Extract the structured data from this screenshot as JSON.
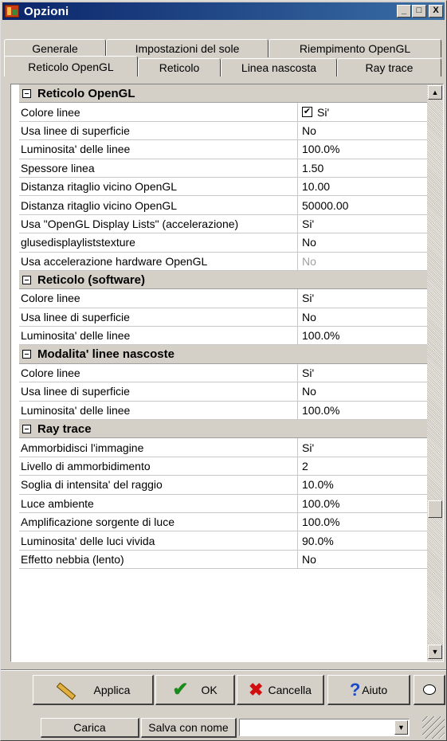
{
  "window": {
    "title": "Opzioni"
  },
  "titlebar_buttons": {
    "minimize": "_",
    "maximize": "□",
    "close": "X"
  },
  "tabs_back": [
    "Generale",
    "Impostazioni del sole",
    "Riempimento OpenGL"
  ],
  "tabs_front": [
    "Reticolo OpenGL",
    "Reticolo",
    "Linea nascosta",
    "Ray trace"
  ],
  "active_tab": "Reticolo OpenGL",
  "grid": {
    "sections": [
      {
        "title": "Reticolo OpenGL",
        "rows": [
          {
            "name": "Colore linee",
            "value": "Si'",
            "checkbox": true
          },
          {
            "name": "Usa linee di superficie",
            "value": "No"
          },
          {
            "name": "Luminosita' delle linee",
            "value": "100.0%"
          },
          {
            "name": "Spessore linea",
            "value": "1.50"
          },
          {
            "name": "Distanza ritaglio vicino OpenGL",
            "value": "10.00"
          },
          {
            "name": "Distanza ritaglio vicino OpenGL",
            "value": "50000.00"
          },
          {
            "name": "Usa \"OpenGL Display Lists\" (accelerazione)",
            "value": "Si'"
          },
          {
            "name": "glusedisplayliststexture",
            "value": "No"
          },
          {
            "name": "Usa accelerazione hardware OpenGL",
            "value": "No",
            "disabled": true
          }
        ]
      },
      {
        "title": "Reticolo (software)",
        "rows": [
          {
            "name": "Colore linee",
            "value": "Si'"
          },
          {
            "name": "Usa linee di superficie",
            "value": "No"
          },
          {
            "name": "Luminosita' delle linee",
            "value": "100.0%"
          }
        ]
      },
      {
        "title": "Modalita' linee nascoste",
        "rows": [
          {
            "name": "Colore linee",
            "value": "Si'"
          },
          {
            "name": "Usa linee di superficie",
            "value": "No"
          },
          {
            "name": "Luminosita' delle linee",
            "value": "100.0%"
          }
        ]
      },
      {
        "title": "Ray trace",
        "rows": [
          {
            "name": "Ammorbidisci l'immagine",
            "value": "Si'"
          },
          {
            "name": "Livello di ammorbidimento",
            "value": "2"
          },
          {
            "name": "Soglia di intensita' del raggio",
            "value": "10.0%"
          },
          {
            "name": "Luce ambiente",
            "value": "100.0%"
          },
          {
            "name": "Amplificazione sorgente di luce",
            "value": "100.0%"
          },
          {
            "name": "Luminosita' delle luci vivida",
            "value": "90.0%"
          },
          {
            "name": "Effetto nebbia (lento)",
            "value": "No"
          }
        ]
      }
    ]
  },
  "buttons": {
    "apply": "Applica",
    "ok": "OK",
    "cancel": "Cancella",
    "help": "Aiuto",
    "load": "Carica",
    "save_as": "Salva con nome"
  },
  "icons": {
    "ok": "✔",
    "cancel": "✖",
    "help": "?",
    "dropdown": "▼",
    "scroll_up": "▲",
    "scroll_down": "▼"
  },
  "preset_combo": {
    "value": ""
  }
}
